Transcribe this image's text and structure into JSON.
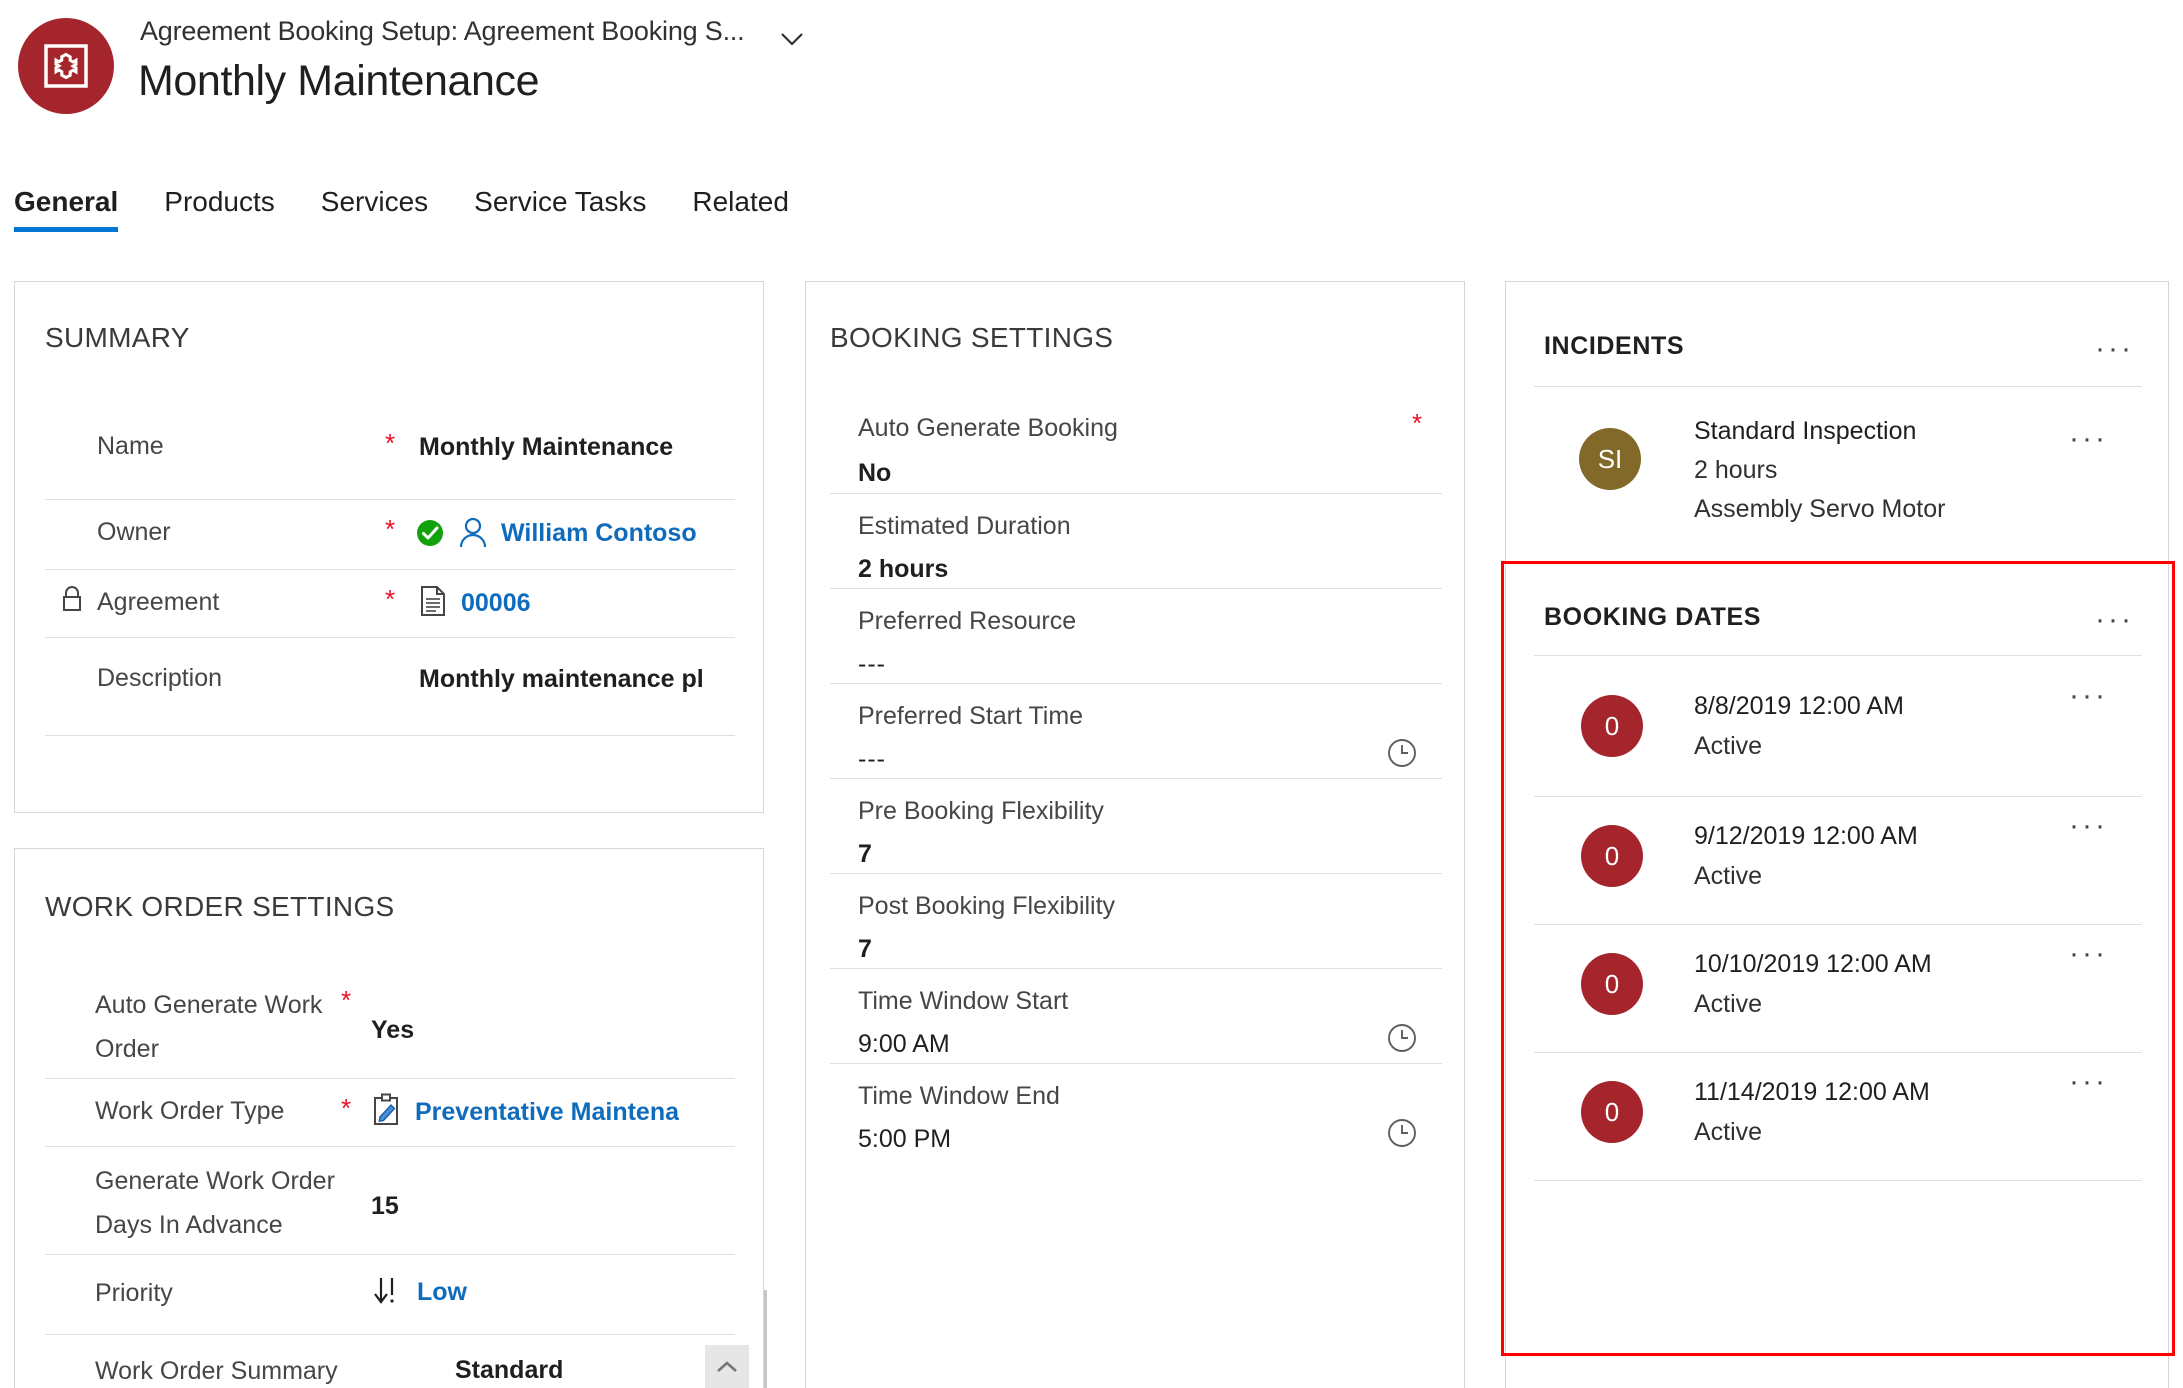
{
  "header": {
    "breadcrumb": "Agreement Booking Setup: Agreement Booking S...",
    "title": "Monthly Maintenance",
    "avatar_icon": "gear-in-square-icon",
    "chevron_icon": "chevron-down-icon",
    "brand_color": "#A4262C"
  },
  "tabs": [
    {
      "label": "General",
      "active": true
    },
    {
      "label": "Products",
      "active": false
    },
    {
      "label": "Services",
      "active": false
    },
    {
      "label": "Service Tasks",
      "active": false
    },
    {
      "label": "Related",
      "active": false
    }
  ],
  "summary": {
    "title": "SUMMARY",
    "rows": [
      {
        "label": "Name",
        "required": "*",
        "value": "Monthly Maintenance",
        "kind": "text"
      },
      {
        "label": "Owner",
        "required": "*",
        "value": "William Contoso",
        "kind": "link",
        "icons": [
          "check-circle-icon",
          "person-icon"
        ]
      },
      {
        "label": "Agreement",
        "required": "*",
        "value": "00006",
        "kind": "link",
        "icons": [
          "lock-icon",
          "document-icon"
        ]
      },
      {
        "label": "Description",
        "required": "",
        "value": "Monthly maintenance pl",
        "kind": "text"
      }
    ]
  },
  "work_order_settings": {
    "title": "WORK ORDER SETTINGS",
    "rows": [
      {
        "label": "Auto Generate Work Order",
        "required": "*",
        "value": "Yes",
        "kind": "text"
      },
      {
        "label": "Work Order Type",
        "required": "*",
        "value": "Preventative Maintena",
        "kind": "link",
        "icons": [
          "clipboard-pencil-icon"
        ]
      },
      {
        "label": "Generate Work Order Days In Advance",
        "required": "",
        "value": "15",
        "kind": "text"
      },
      {
        "label": "Priority",
        "required": "",
        "value": "Low",
        "kind": "link",
        "icons": [
          "arrow-down-priority-icon"
        ]
      },
      {
        "label": "Work Order Summary",
        "required": "",
        "value": "Standard",
        "kind": "text"
      }
    ]
  },
  "booking_settings": {
    "title": "BOOKING SETTINGS",
    "rows": [
      {
        "label": "Auto Generate Booking",
        "required": "*",
        "value": "No",
        "kind": "bold"
      },
      {
        "label": "Estimated Duration",
        "required": "",
        "value": "2 hours",
        "kind": "bold"
      },
      {
        "label": "Preferred Resource",
        "required": "",
        "value": "---",
        "kind": "dashes"
      },
      {
        "label": "Preferred Start Time",
        "required": "",
        "value": "---",
        "kind": "dashes",
        "trailing_icon": "clock-icon"
      },
      {
        "label": "Pre Booking Flexibility",
        "required": "",
        "value": "7",
        "kind": "bold"
      },
      {
        "label": "Post Booking Flexibility",
        "required": "",
        "value": "7",
        "kind": "bold"
      },
      {
        "label": "Time Window Start",
        "required": "",
        "value": "9:00 AM",
        "kind": "normal",
        "trailing_icon": "clock-icon"
      },
      {
        "label": "Time Window End",
        "required": "",
        "value": "5:00 PM",
        "kind": "normal",
        "trailing_icon": "clock-icon"
      }
    ]
  },
  "incidents": {
    "title": "INCIDENTS",
    "more_icon": "more-options-icon",
    "items": [
      {
        "initials": "SI",
        "bubble_color": "#82692a",
        "title": "Standard Inspection",
        "line2": "2 hours",
        "line3": "Assembly Servo Motor",
        "more_icon": "more-options-icon"
      }
    ]
  },
  "booking_dates": {
    "title": "BOOKING DATES",
    "more_icon": "more-options-icon",
    "highlighted": true,
    "highlight_color": "#ff0000",
    "bubble_color": "#A4262C",
    "items": [
      {
        "badge": "0",
        "date": "8/8/2019 12:00 AM",
        "status": "Active",
        "more_icon": "more-options-icon"
      },
      {
        "badge": "0",
        "date": "9/12/2019 12:00 AM",
        "status": "Active",
        "more_icon": "more-options-icon"
      },
      {
        "badge": "0",
        "date": "10/10/2019 12:00 AM",
        "status": "Active",
        "more_icon": "more-options-icon"
      },
      {
        "badge": "0",
        "date": "11/14/2019 12:00 AM",
        "status": "Active",
        "more_icon": "more-options-icon"
      }
    ]
  },
  "scrollbar": {
    "up_arrow_icon": "chevron-up-icon"
  }
}
